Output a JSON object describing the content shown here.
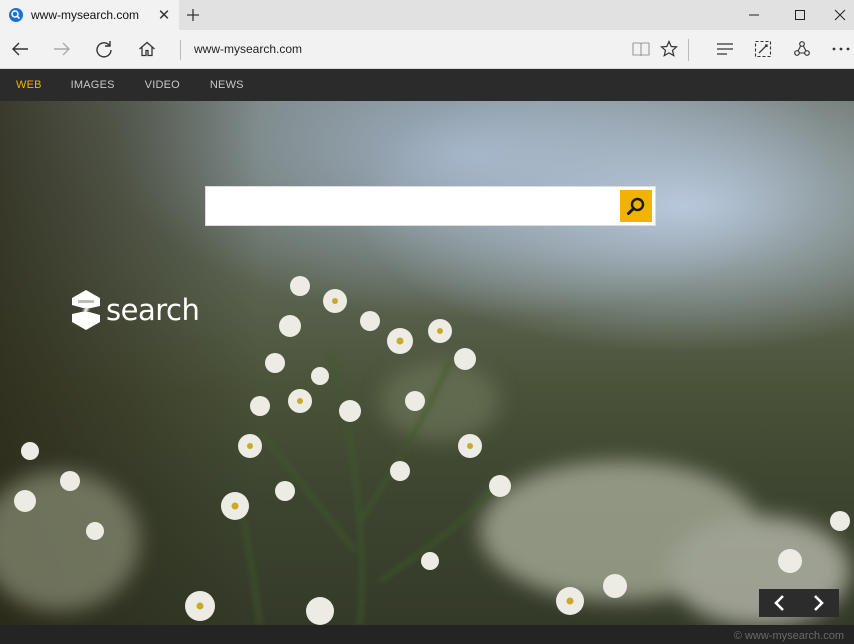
{
  "tab": {
    "title": "www-mysearch.com",
    "favicon": "search-favicon-icon"
  },
  "window_controls": {
    "minimize": "minimize-icon",
    "maximize": "maximize-icon",
    "close": "close-icon"
  },
  "toolbar": {
    "address": "www-mysearch.com"
  },
  "categories": [
    {
      "label": "WEB",
      "active": true
    },
    {
      "label": "IMAGES",
      "active": false
    },
    {
      "label": "VIDEO",
      "active": false
    },
    {
      "label": "NEWS",
      "active": false
    }
  ],
  "logo": {
    "word": "search"
  },
  "search": {
    "query": "",
    "placeholder": ""
  },
  "footer": {
    "text": "© www-mysearch.com"
  },
  "colors": {
    "accent": "#f0b400",
    "nav_bg": "#2b2b2b",
    "chrome_bg": "#f2f2f2"
  }
}
